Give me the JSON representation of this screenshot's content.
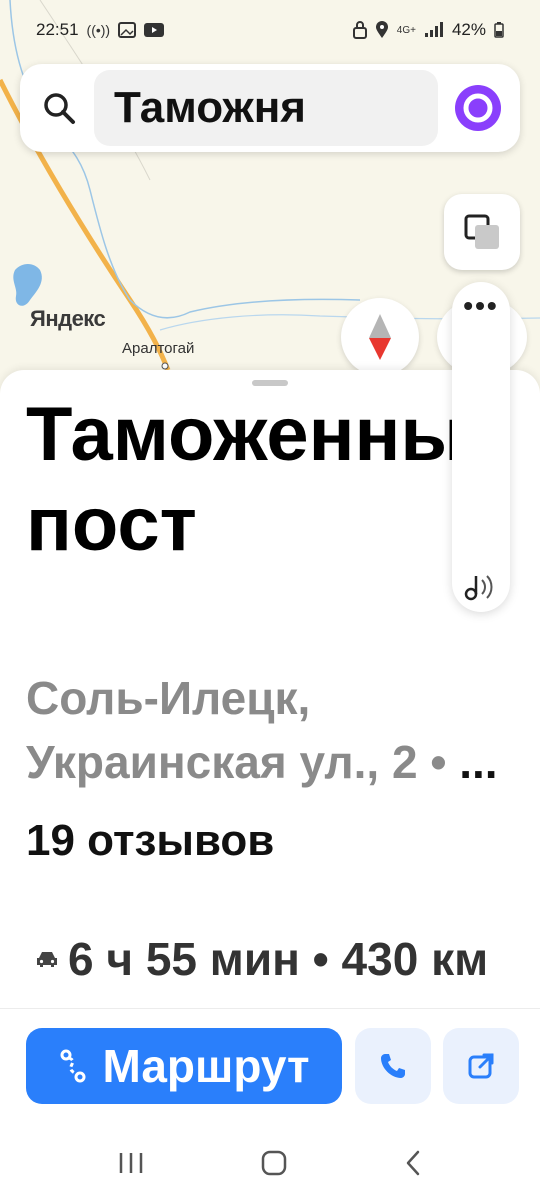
{
  "status_bar": {
    "time": "22:51",
    "battery": "42%",
    "network": "4G+"
  },
  "search": {
    "query": "Таможня"
  },
  "map": {
    "labels": {
      "brand": "Яндекс",
      "town": "Аралтогай"
    }
  },
  "place": {
    "title": "Таможенный пост",
    "address": "Соль-Илецк, Украинская ул., 2 •",
    "address_more": "...",
    "reviews": "19 отзывов",
    "route_info": "6 ч 55 мин • 430 км"
  },
  "actions": {
    "route_label": "Маршрут"
  },
  "side_panel": {
    "more": "•••"
  },
  "colors": {
    "accent": "#2a7ffb",
    "alice": "#8a3ffc",
    "compass_red": "#e8372f"
  }
}
